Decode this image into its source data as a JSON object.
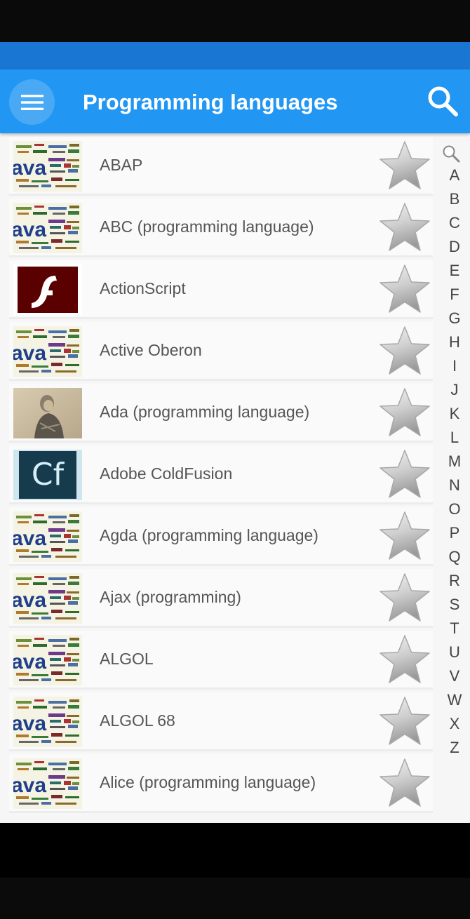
{
  "app_bar": {
    "title": "Programming languages",
    "menu_icon": "menu-icon",
    "search_icon": "search-icon"
  },
  "colors": {
    "app_bar": "#2196f3",
    "status_bar": "#1976d2",
    "list_background": "#fafafa"
  },
  "items": [
    {
      "label": "ABAP",
      "thumbnail": "java-wordcloud-logo"
    },
    {
      "label": "ABC (programming language)",
      "thumbnail": "java-wordcloud-logo"
    },
    {
      "label": "ActionScript",
      "thumbnail": "flash-logo"
    },
    {
      "label": "Active Oberon",
      "thumbnail": "java-wordcloud-logo"
    },
    {
      "label": "Ada (programming language)",
      "thumbnail": "ada-lovelace-portrait"
    },
    {
      "label": "Adobe ColdFusion",
      "thumbnail": "coldfusion-logo"
    },
    {
      "label": "Agda (programming language)",
      "thumbnail": "java-wordcloud-logo"
    },
    {
      "label": "Ajax (programming)",
      "thumbnail": "java-wordcloud-logo"
    },
    {
      "label": "ALGOL",
      "thumbnail": "java-wordcloud-logo"
    },
    {
      "label": "ALGOL 68",
      "thumbnail": "java-wordcloud-logo"
    },
    {
      "label": "Alice (programming language)",
      "thumbnail": "java-wordcloud-logo"
    }
  ],
  "coldfusion_text": "Cf",
  "wordcloud_text": "ava",
  "index": {
    "search_icon": "index-search-icon",
    "letters": [
      "A",
      "B",
      "C",
      "D",
      "E",
      "F",
      "G",
      "H",
      "I",
      "J",
      "K",
      "L",
      "M",
      "N",
      "O",
      "P",
      "Q",
      "R",
      "S",
      "T",
      "U",
      "V",
      "W",
      "X",
      "Z"
    ]
  }
}
